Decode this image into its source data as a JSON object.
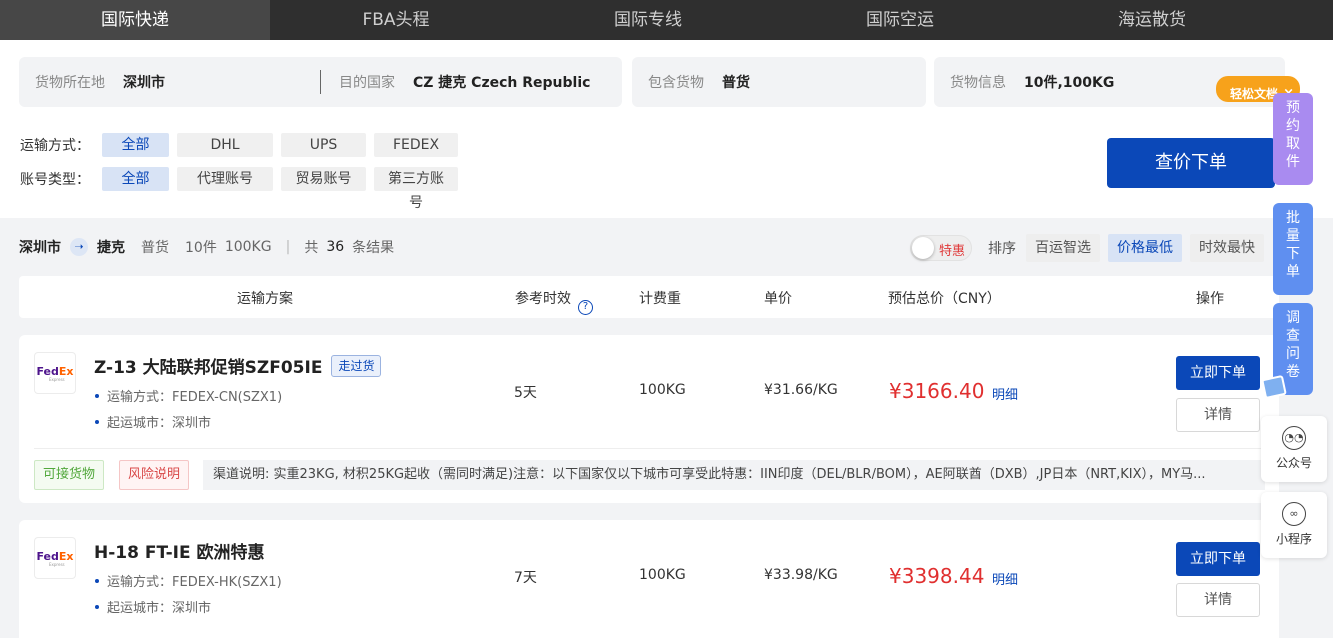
{
  "nav": {
    "tabs": [
      "国际快递",
      "FBA头程",
      "国际专线",
      "国际空运",
      "海运散货"
    ],
    "active_index": 0
  },
  "search": {
    "origin_label": "货物所在地",
    "origin_value": "深圳市",
    "dest_label": "目的国家",
    "dest_value": "CZ 捷克 Czech Republic",
    "goods_label": "包含货物",
    "goods_value": "普货",
    "info_label": "货物信息",
    "info_value": "10件,100KG",
    "promo": "轻松文档"
  },
  "filters": {
    "transport_label": "运输方式：",
    "transport_options": [
      "全部",
      "DHL",
      "UPS",
      "FEDEX"
    ],
    "account_label": "账号类型：",
    "account_options": [
      "全部",
      "代理账号",
      "贸易账号",
      "第三方账号"
    ],
    "query_button": "查价下单"
  },
  "summary": {
    "origin": "深圳市",
    "dest": "捷克",
    "goods": "普货",
    "pieces": "10件",
    "weight": "100KG",
    "prefix": "共",
    "count": "36",
    "suffix": "条结果",
    "toggle_label": "特惠",
    "sort_label": "排序",
    "sort_options": [
      "百运智选",
      "价格最低",
      "时效最快"
    ],
    "active_sort": "价格最低"
  },
  "table": {
    "headers": {
      "plan": "运输方案",
      "time": "参考时效",
      "weight": "计费重",
      "unit": "单价",
      "total": "预估总价（CNY）",
      "action": "操作"
    }
  },
  "results": [
    {
      "logo": "FedEx",
      "name": "Z-13 大陆联邦促销SZF05IE",
      "badge": "走过货",
      "method": "运输方式：FEDEX-CN(SZX1)",
      "city": "起运城市：深圳市",
      "time": "5天",
      "weight": "100KG",
      "unit_price": "¥31.66/KG",
      "total": "¥3166.40",
      "detail_link": "明细",
      "order_button": "立即下单",
      "info_button": "详情",
      "tag_ok": "可接货物",
      "tag_risk": "风险说明",
      "note": "渠道说明: 实重23KG, 材积25KG起收（需同时满足)注意：以下国家仅以下城市可享受此特惠：IIN印度（DEL/BLR/BOM），AE阿联酋（DXB）,JP日本（NRT,KIX），MY马..."
    },
    {
      "logo": "FedEx",
      "name": "H-18 FT-IE 欧洲特惠",
      "method": "运输方式：FEDEX-HK(SZX1)",
      "city": "起运城市：深圳市",
      "time": "7天",
      "weight": "100KG",
      "unit_price": "¥33.98/KG",
      "total": "¥3398.44",
      "detail_link": "明细",
      "order_button": "立即下单",
      "info_button": "详情"
    }
  ],
  "side": {
    "pickup": [
      "预",
      "约",
      "取",
      "件"
    ],
    "batch": [
      "批",
      "量",
      "下",
      "单"
    ],
    "survey": [
      "调",
      "查",
      "问",
      "卷"
    ],
    "wechat": "公众号",
    "miniapp": "小程序"
  },
  "colors": {
    "brand_blue": "#0b48b8",
    "price_red": "#e02f2f",
    "nav_bg": "#2f2f2f"
  }
}
